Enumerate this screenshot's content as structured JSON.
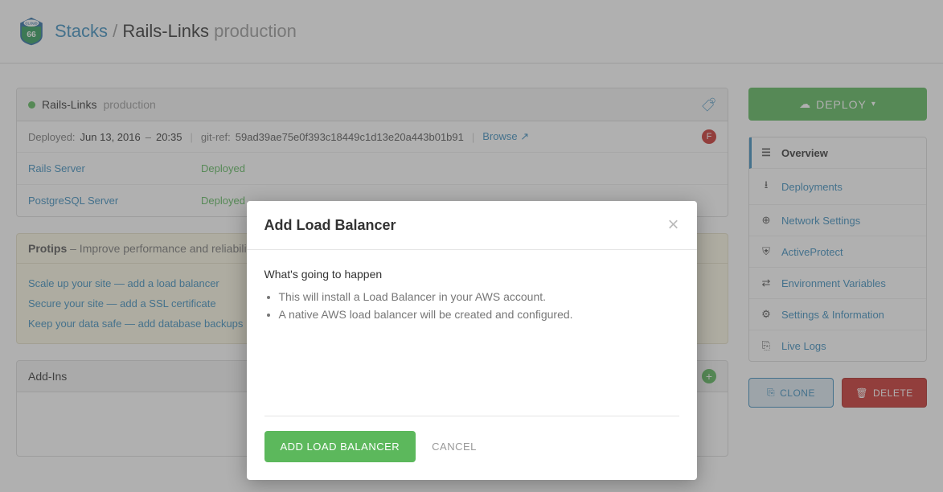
{
  "breadcrumb": {
    "root": "Stacks",
    "sep": "/",
    "stack": "Rails-Links",
    "env": "production"
  },
  "stack_panel": {
    "name": "Rails-Links",
    "env": "production",
    "deployed_label": "Deployed:",
    "date": "Jun 13, 2016",
    "dash": "–",
    "time": "20:35",
    "git_label": "git-ref:",
    "git_ref": "59ad39ae75e0f393c18449c1d13e20a443b01b91",
    "browse": "Browse",
    "badge": "F",
    "services": [
      {
        "name": "Rails Server",
        "status": "Deployed"
      },
      {
        "name": "PostgreSQL Server",
        "status": "Deployed"
      }
    ]
  },
  "protips": {
    "title": "Protips",
    "subtitle": "– Improve performance and reliability",
    "items": [
      "Scale up your site — add a load balancer",
      "Secure your site — add a SSL certificate",
      "Keep your data safe — add database backups"
    ]
  },
  "addins": {
    "title": "Add-Ins"
  },
  "sidebar": {
    "deploy": "DEPLOY",
    "items": [
      {
        "label": "Overview",
        "icon": "☰",
        "active": true
      },
      {
        "label": "Deployments",
        "icon": "⭳"
      },
      {
        "label": "Network Settings",
        "icon": "⊕"
      },
      {
        "label": "ActiveProtect",
        "icon": "⛨"
      },
      {
        "label": "Environment Variables",
        "icon": "⇄"
      },
      {
        "label": "Settings & Information",
        "icon": "⚙"
      },
      {
        "label": "Live Logs",
        "icon": "⎘"
      }
    ],
    "clone": "CLONE",
    "delete": "DELETE"
  },
  "modal": {
    "title": "Add Load Balancer",
    "heading": "What's going to happen",
    "bullets": [
      "This will install a Load Balancer in your AWS account.",
      "A native AWS load balancer will be created and configured."
    ],
    "confirm": "ADD LOAD BALANCER",
    "cancel": "CANCEL"
  }
}
